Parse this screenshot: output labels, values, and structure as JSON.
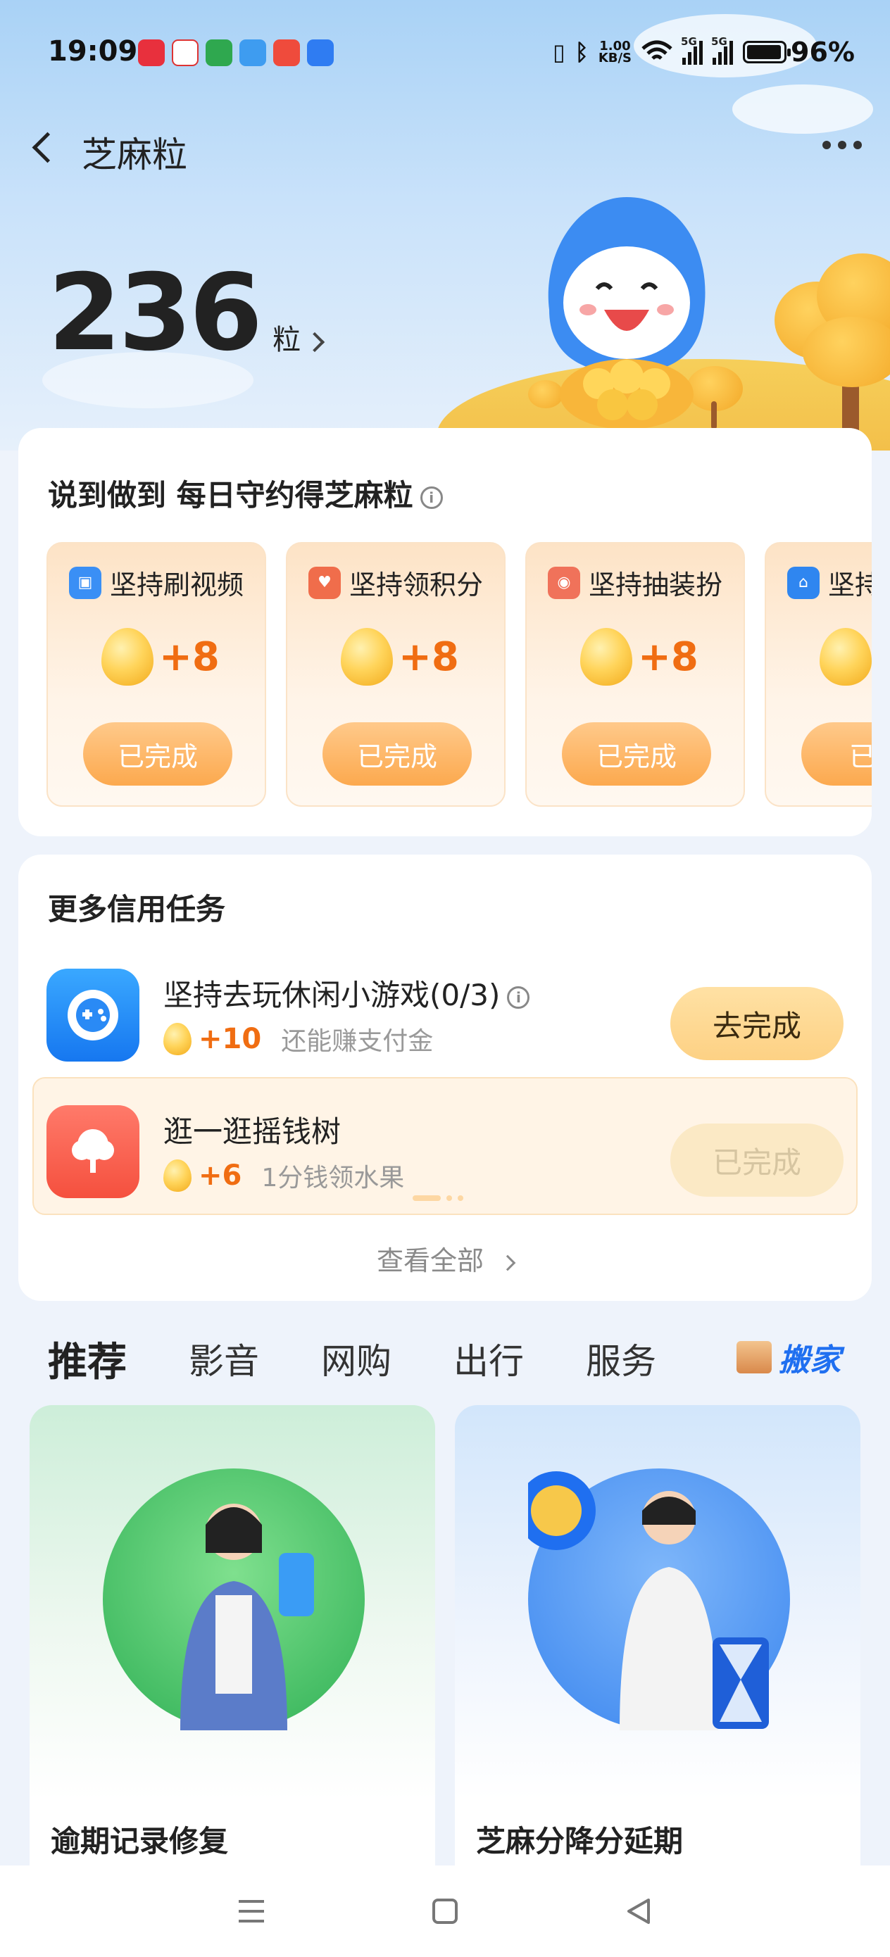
{
  "status_bar": {
    "time": "19:09",
    "net_speed_value": "1.00",
    "net_speed_unit": "KB/S",
    "signal_1": "5G",
    "signal_2": "5G",
    "battery_percent": "96%",
    "battery_level": 0.96,
    "notification_icons": [
      "app-red-icon",
      "mail-icon",
      "oppo-icon",
      "weather-icon",
      "news-icon",
      "browser-icon"
    ]
  },
  "nav": {
    "title": "芝麻粒"
  },
  "points": {
    "value": "236",
    "unit": "粒"
  },
  "daily_card": {
    "title": "说到做到 每日守约得芝麻粒",
    "tiles": [
      {
        "label": "坚持刷视频",
        "reward": "+8",
        "button": "已完成",
        "icon_color": "#3a8ff5"
      },
      {
        "label": "坚持领积分",
        "reward": "+8",
        "button": "已完成",
        "icon_color": "#f06d4b"
      },
      {
        "label": "坚持抽装扮",
        "reward": "+8",
        "button": "已完成",
        "icon_color": "#f0725a"
      },
      {
        "label": "坚持",
        "reward": "",
        "button": "已完",
        "icon_color": "#2f86f0"
      }
    ]
  },
  "credit_card": {
    "title": "更多信用任务",
    "tasks": [
      {
        "title": "坚持去玩休闲小游戏(0/3)",
        "reward": "+10",
        "desc": "还能赚支付金",
        "button": "去完成"
      },
      {
        "title": "逛一逛摇钱树",
        "reward": "+6",
        "desc": "1分钱领水果",
        "button": "已完成"
      }
    ],
    "view_all": "查看全部"
  },
  "tabs": {
    "items": [
      "推荐",
      "影音",
      "网购",
      "出行",
      "服务"
    ],
    "special": "搬家"
  },
  "recommend": [
    {
      "title": "逾期记录修复"
    },
    {
      "title": "芝麻分降分延期"
    }
  ],
  "colors": {
    "accent_orange": "#f06d12",
    "button_orange": "#fca94e",
    "link_blue": "#1f6ff0"
  }
}
